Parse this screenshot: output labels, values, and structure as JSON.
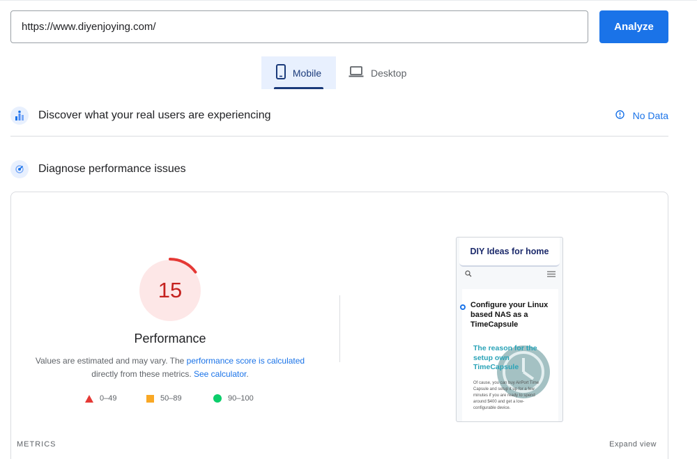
{
  "search": {
    "url_value": "https://www.diyenjoying.com/",
    "analyze_label": "Analyze"
  },
  "tabs": [
    {
      "label": "Mobile",
      "selected": true
    },
    {
      "label": "Desktop",
      "selected": false
    }
  ],
  "field_data": {
    "title": "Discover what your real users are experiencing",
    "status": "No Data"
  },
  "diagnose": {
    "title": "Diagnose performance issues"
  },
  "performance": {
    "score": "15",
    "score_fraction": 0.15,
    "label": "Performance",
    "note_prefix": "Values are estimated and may vary. The ",
    "note_link1": "performance score is calculated",
    "note_middle": "directly from these metrics. ",
    "note_link2": "See calculator",
    "note_suffix": ".",
    "legend": [
      {
        "range": "0–49"
      },
      {
        "range": "50–89"
      },
      {
        "range": "90–100"
      }
    ],
    "colors": {
      "fail": "#e53935",
      "fail_bg": "#fde7e7",
      "average": "#f9a825",
      "pass": "#0cce6b"
    }
  },
  "preview": {
    "site_title": "DIY Ideas for home",
    "post_title": "Configure your Linux based NAS as a TimeCapsule",
    "subheading": "The reason for the setup own TimeCapsule",
    "body": "Of cause, you can buy AirPort Time Capsule and setup it up for a few minutes if you are ready to spend around $400 and get a low-configurable device."
  },
  "footer": {
    "metrics_label": "METRICS",
    "expand_label": "Expand view"
  },
  "icons": {
    "mobile": "mobile-phone-icon",
    "desktop": "laptop-icon",
    "field": "users-chart-icon",
    "diagnose": "lab-diagnose-icon",
    "info": "info-circle-icon",
    "search": "search-icon",
    "menu": "hamburger-menu-icon"
  },
  "accent_color": "#1a73e8"
}
